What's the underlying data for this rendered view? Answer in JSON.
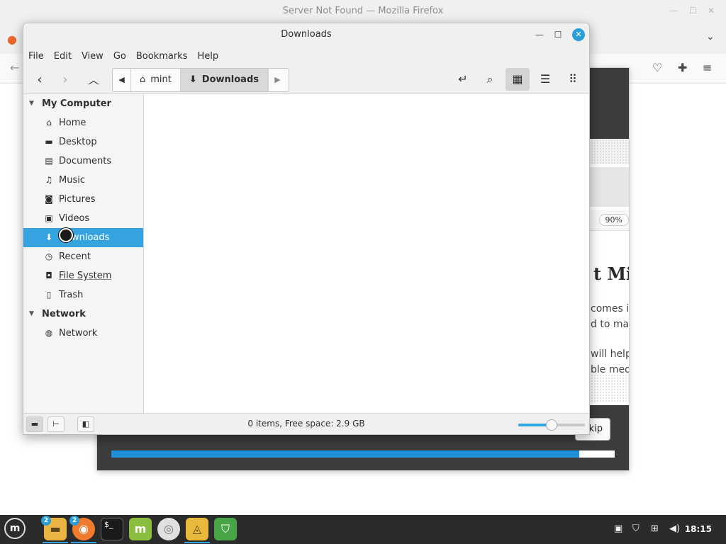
{
  "firefox": {
    "title": "Server Not Found — Mozilla Firefox"
  },
  "slideshow": {
    "zoom": "90%",
    "heading": "t Min",
    "lines": [
      "comes in",
      "d to mak",
      "will help",
      "ble medi"
    ],
    "skip_label": "kip",
    "progress": 0.93
  },
  "nemo": {
    "title": "Downloads",
    "menu": [
      "File",
      "Edit",
      "View",
      "Go",
      "Bookmarks",
      "Help"
    ],
    "path": [
      {
        "label": "mint",
        "icon": "home-icon"
      },
      {
        "label": "Downloads",
        "icon": "download-icon"
      }
    ],
    "sidebar": {
      "sections": [
        {
          "header": "My Computer",
          "items": [
            {
              "label": "Home",
              "icon": "home-icon"
            },
            {
              "label": "Desktop",
              "icon": "desktop-icon"
            },
            {
              "label": "Documents",
              "icon": "documents-icon"
            },
            {
              "label": "Music",
              "icon": "music-icon"
            },
            {
              "label": "Pictures",
              "icon": "camera-icon"
            },
            {
              "label": "Videos",
              "icon": "film-icon"
            },
            {
              "label": "Downloads",
              "icon": "download-icon",
              "selected": true
            },
            {
              "label": "Recent",
              "icon": "clock-icon"
            },
            {
              "label": "File System",
              "icon": "drive-icon"
            },
            {
              "label": "Trash",
              "icon": "trash-icon"
            }
          ]
        },
        {
          "header": "Network",
          "items": [
            {
              "label": "Network",
              "icon": "globe-icon"
            }
          ]
        }
      ]
    },
    "status": "0 items, Free space: 2.9 GB",
    "zoom_level": 0.5
  },
  "taskbar": {
    "badges": {
      "files": "2",
      "firefox": "2"
    },
    "clock": "18:15"
  },
  "colors": {
    "accent": "#35a3e0",
    "close": "#2a9fd6",
    "taskbar": "#2b2b2b"
  }
}
